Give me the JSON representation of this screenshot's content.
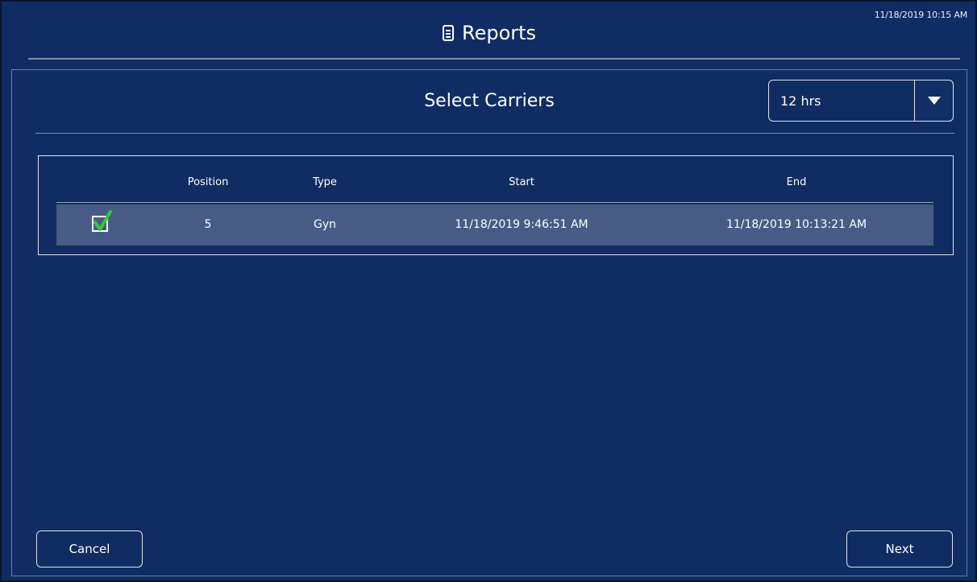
{
  "header": {
    "title": "Reports",
    "icon": "report-document-icon",
    "timestamp": "11/18/2019 10:15 AM"
  },
  "panel": {
    "title": "Select Carriers",
    "time_range": {
      "value": "12 hrs",
      "icon": "dropdown-caret-icon"
    }
  },
  "table": {
    "columns": [
      "",
      "Position",
      "Type",
      "Start",
      "End"
    ],
    "rows": [
      {
        "checked": true,
        "position": "5",
        "type": "Gyn",
        "start": "11/18/2019 9:46:51 AM",
        "end": "11/18/2019 10:13:21 AM"
      }
    ]
  },
  "footer": {
    "cancel_label": "Cancel",
    "next_label": "Next"
  },
  "colors": {
    "background": "#102d63",
    "row_highlight": "#465c87",
    "check_green": "#34c93a",
    "border": "#d8dfeb"
  }
}
